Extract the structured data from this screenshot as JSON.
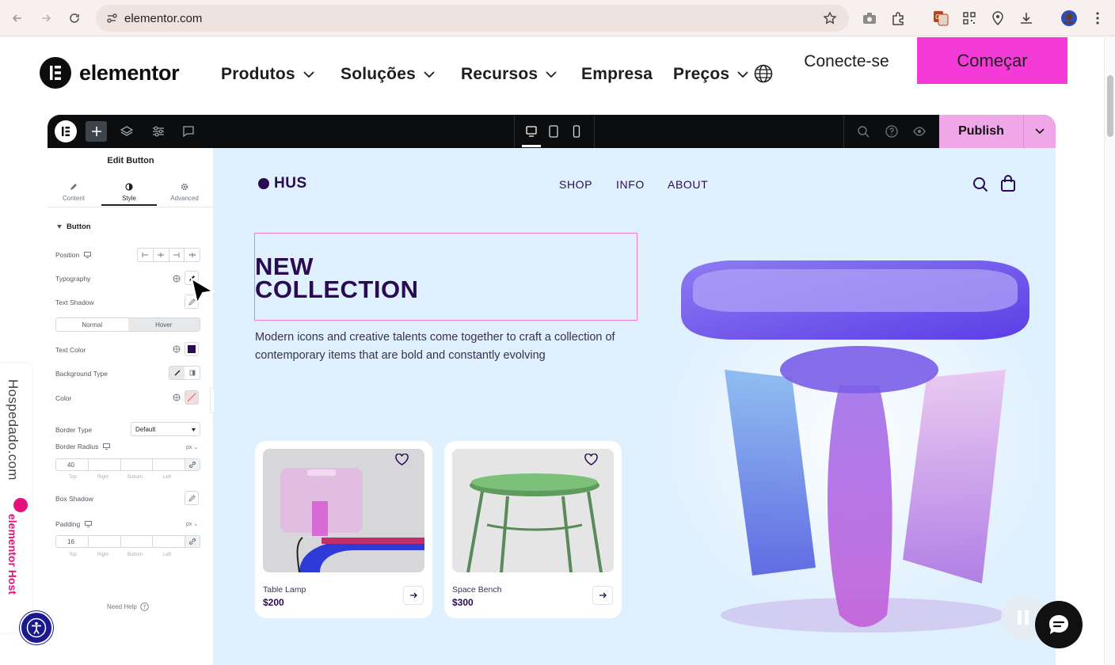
{
  "browser": {
    "url": "elementor.com"
  },
  "site_header": {
    "logo_text": "elementor",
    "nav": [
      {
        "label": "Produtos"
      },
      {
        "label": "Soluções"
      },
      {
        "label": "Recursos"
      },
      {
        "label": "Empresa"
      },
      {
        "label": "Preços"
      }
    ],
    "login_label": "Conecte-se",
    "cta_label": "Começar",
    "cta_color": "#f43bd8"
  },
  "editor": {
    "publish_label": "Publish",
    "panel": {
      "title": "Edit Button",
      "tabs": [
        "Content",
        "Style",
        "Advanced"
      ],
      "active_tab": "Style",
      "section_label": "Button",
      "labels": {
        "position": "Position",
        "typography": "Typography",
        "text_shadow": "Text Shadow",
        "normal": "Normal",
        "hover": "Hover",
        "text_color": "Text Color",
        "background_type": "Background Type",
        "color": "Color",
        "border_type": "Border Type",
        "border_radius": "Border Radius",
        "box_shadow": "Box Shadow",
        "padding": "Padding",
        "need_help": "Need Help"
      },
      "border_type_value": "Default",
      "border_radius_value": "40",
      "padding_value": "16",
      "unit": "px",
      "dim_labels": [
        "Top",
        "Right",
        "Bottom",
        "Left"
      ],
      "text_color_swatch": "#2a0a52"
    },
    "canvas": {
      "brand": "HUS",
      "nav": [
        "SHOP",
        "INFO",
        "ABOUT"
      ],
      "hero_line1": "NEW",
      "hero_line2": "COLLECTION",
      "hero_desc": "Modern icons and creative talents come together to craft a collection of contemporary items that are bold and constantly evolving",
      "products": [
        {
          "name": "Table Lamp",
          "price": "$200"
        },
        {
          "name": "Space Bench",
          "price": "$300"
        }
      ]
    }
  },
  "side_widget": {
    "host_text": "Hospedado.com",
    "brand_text": "elementor Host"
  }
}
